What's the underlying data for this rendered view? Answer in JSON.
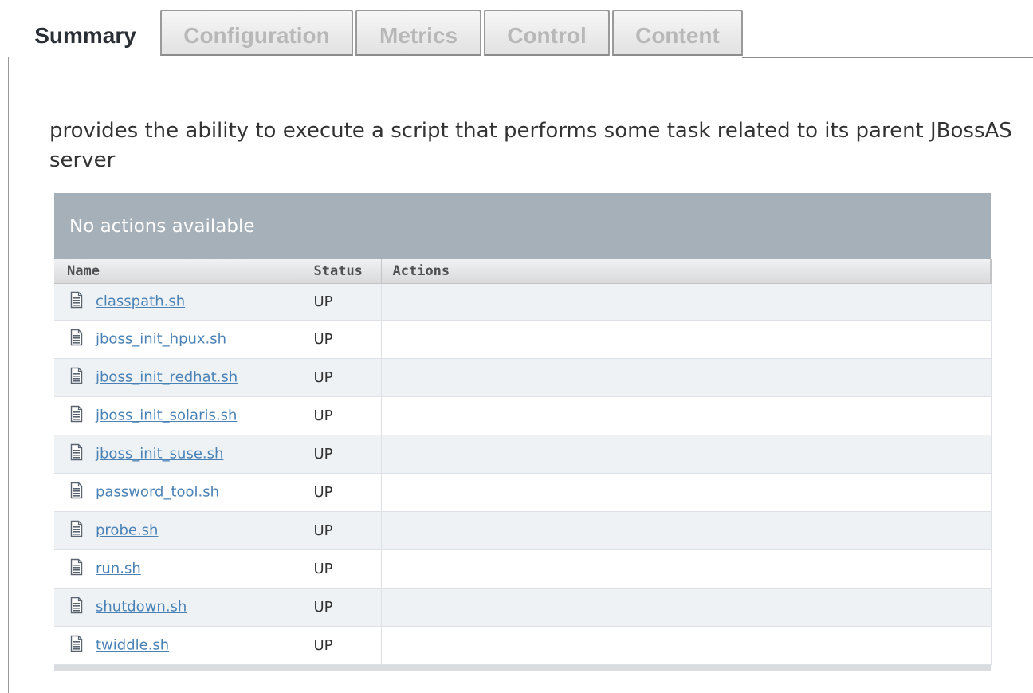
{
  "tabs": [
    {
      "label": "Summary",
      "active": true
    },
    {
      "label": "Configuration",
      "active": false
    },
    {
      "label": "Metrics",
      "active": false
    },
    {
      "label": "Control",
      "active": false
    },
    {
      "label": "Content",
      "active": false
    }
  ],
  "description": "provides the ability to execute a script that performs some task related to its parent JBossAS server",
  "grid": {
    "title": "No actions available",
    "columns": {
      "name": "Name",
      "status": "Status",
      "actions": "Actions"
    },
    "rows": [
      {
        "name": "classpath.sh",
        "status": "UP",
        "actions": ""
      },
      {
        "name": "jboss_init_hpux.sh",
        "status": "UP",
        "actions": ""
      },
      {
        "name": "jboss_init_redhat.sh",
        "status": "UP",
        "actions": ""
      },
      {
        "name": "jboss_init_solaris.sh",
        "status": "UP",
        "actions": ""
      },
      {
        "name": "jboss_init_suse.sh",
        "status": "UP",
        "actions": ""
      },
      {
        "name": "password_tool.sh",
        "status": "UP",
        "actions": ""
      },
      {
        "name": "probe.sh",
        "status": "UP",
        "actions": ""
      },
      {
        "name": "run.sh",
        "status": "UP",
        "actions": ""
      },
      {
        "name": "shutdown.sh",
        "status": "UP",
        "actions": ""
      },
      {
        "name": "twiddle.sh",
        "status": "UP",
        "actions": ""
      }
    ],
    "row_icon": "script-file-icon"
  },
  "colors": {
    "header_bar": "#a6b0b8",
    "link": "#4a82b6",
    "row_alt": "#eef2f5"
  }
}
